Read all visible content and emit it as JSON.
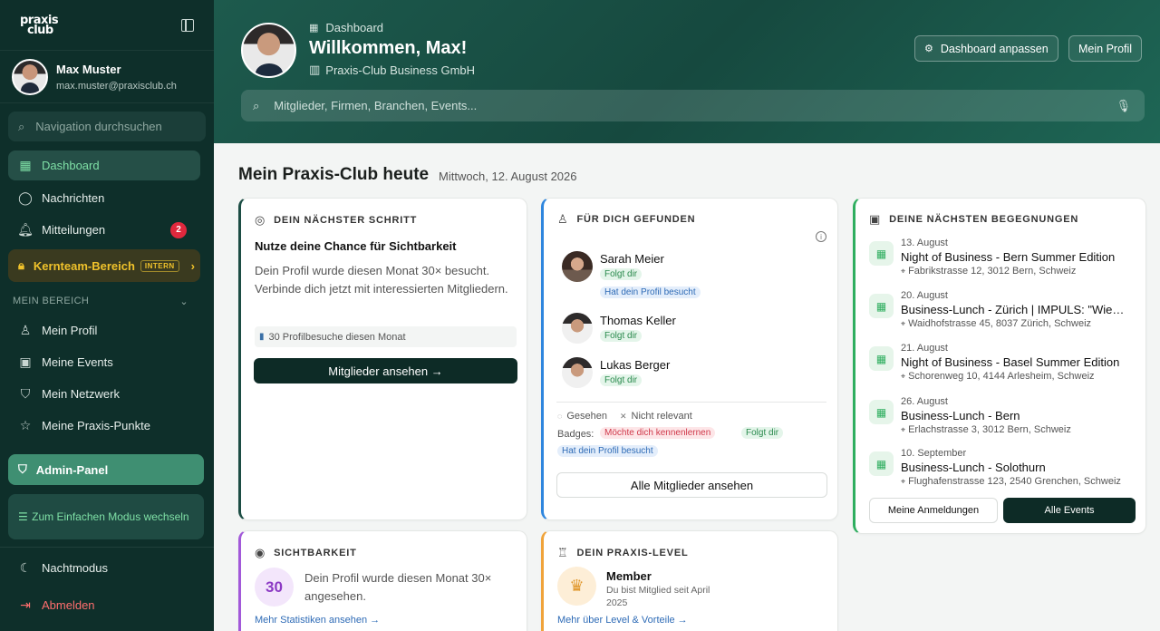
{
  "sidebar": {
    "logo_line1": "praxis",
    "logo_line2": "club",
    "user_name": "Max Muster",
    "user_email": "max.muster@praxisclub.ch",
    "search_placeholder": "Navigation durchsuchen",
    "nav": [
      {
        "label": "Dashboard",
        "icon": "grid-icon"
      },
      {
        "label": "Nachrichten",
        "icon": "chat-icon"
      },
      {
        "label": "Mitteilungen",
        "icon": "bell-icon",
        "badge": "2"
      }
    ],
    "kernteam_label": "Kernteam-Bereich",
    "kernteam_tag": "INTERN",
    "section_title": "MEIN BEREICH",
    "section_items": [
      {
        "label": "Mein Profil",
        "icon": "user-icon"
      },
      {
        "label": "Meine Events",
        "icon": "calendar-icon"
      },
      {
        "label": "Mein Netzwerk",
        "icon": "shield-icon"
      },
      {
        "label": "Meine Praxis-Punkte",
        "icon": "star-icon"
      }
    ],
    "admin_label": "Admin-Panel",
    "simple_mode_label": "Zum Einfachen Modus wechseln",
    "night_mode_label": "Nachtmodus",
    "logout_label": "Abmelden"
  },
  "header": {
    "breadcrumb": "Dashboard",
    "welcome": "Willkommen, Max!",
    "company": "Praxis-Club Business GmbH",
    "customize_label": "Dashboard anpassen",
    "profile_label": "Mein Profil",
    "search_placeholder": "Mitglieder, Firmen, Branchen, Events..."
  },
  "main": {
    "title": "Mein Praxis-Club heute",
    "date": "Mittwoch, 12. August 2026"
  },
  "next_step": {
    "heading": "DEIN NÄCHSTER SCHRITT",
    "title": "Nutze deine Chance für Sichtbarkeit",
    "text": "Dein Profil wurde diesen Monat 30× besucht. Verbinde dich jetzt mit interessierten Mitgliedern.",
    "stat": "30 Profilbesuche diesen Monat",
    "cta": "Mitglieder ansehen →"
  },
  "found": {
    "heading": "FÜR DICH GEFUNDEN",
    "people": [
      {
        "name": "Sarah Meier",
        "tags": [
          "Folgt dir",
          "Hat dein Profil besucht"
        ]
      },
      {
        "name": "Thomas Keller",
        "tags": [
          "Folgt dir"
        ]
      },
      {
        "name": "Lukas Berger",
        "tags": [
          "Folgt dir"
        ]
      }
    ],
    "seen": "Gesehen",
    "not_relevant": "Nicht relevant",
    "badges_label": "Badges:",
    "badge_meet": "Möchte dich kennenlernen",
    "badge_follow": "Folgt dir",
    "badge_visit": "Hat dein Profil besucht",
    "all_button": "Alle Mitglieder ansehen"
  },
  "events": {
    "heading": "DEINE NÄCHSTEN BEGEGNUNGEN",
    "items": [
      {
        "date": "13. August",
        "title": "Night of Business - Bern Summer Edition",
        "address": "Fabrikstrasse 12, 3012 Bern, Schweiz"
      },
      {
        "date": "20. August",
        "title": "Business-Lunch - Zürich | IMPULS: \"Wie neue Kunden gewinnen\"",
        "address": "Waidhofstrasse 45, 8037 Zürich, Schweiz"
      },
      {
        "date": "21. August",
        "title": "Night of Business - Basel Summer Edition",
        "address": "Schorenweg 10, 4144 Arlesheim, Schweiz"
      },
      {
        "date": "26. August",
        "title": "Business-Lunch - Bern",
        "address": "Erlachstrasse 3, 3012 Bern, Schweiz"
      },
      {
        "date": "10. September",
        "title": "Business-Lunch - Solothurn",
        "address": "Flughafenstrasse 123, 2540 Grenchen, Schweiz"
      }
    ],
    "registrations_button": "Meine Anmeldungen",
    "all_events_button": "Alle Events"
  },
  "visibility": {
    "heading": "SICHTBARKEIT",
    "count": "30",
    "text": "Dein Profil wurde diesen Monat 30× angesehen.",
    "link": "Mehr Statistiken ansehen →"
  },
  "level": {
    "heading": "DEIN PRAXIS-LEVEL",
    "level": "Member",
    "since": "Du bist Mitglied seit April 2025",
    "link": "Mehr über Level & Vorteile →"
  }
}
